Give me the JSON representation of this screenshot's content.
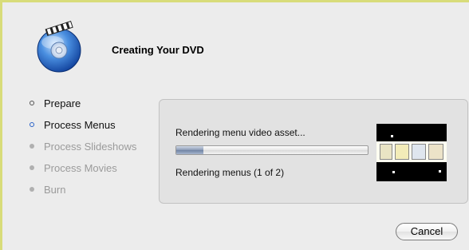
{
  "dialog": {
    "title": "Creating Your DVD"
  },
  "steps": [
    {
      "label": "Prepare",
      "state": "done"
    },
    {
      "label": "Process Menus",
      "state": "active"
    },
    {
      "label": "Process Slideshows",
      "state": "pending"
    },
    {
      "label": "Process Movies",
      "state": "pending"
    },
    {
      "label": "Burn",
      "state": "pending"
    }
  ],
  "status": {
    "title": "Rendering menu video asset...",
    "detail": "Rendering menus (1 of 2)",
    "progress_fraction": 0.14
  },
  "buttons": {
    "cancel_label": "Cancel"
  },
  "colors": {
    "window_border": "#d8dc7a",
    "active_step": "#2a62c8",
    "pending_step": "#9b9b9b"
  },
  "icons": {
    "app_icon": "idvd-disc-icon"
  }
}
